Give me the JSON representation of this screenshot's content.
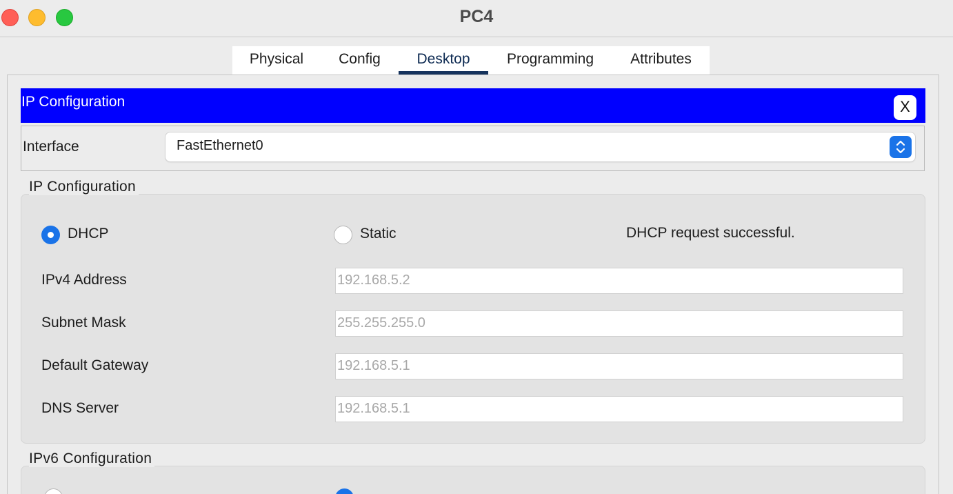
{
  "window": {
    "title": "PC4"
  },
  "tabs": [
    {
      "label": "Physical"
    },
    {
      "label": "Config"
    },
    {
      "label": "Desktop",
      "active": true
    },
    {
      "label": "Programming"
    },
    {
      "label": "Attributes"
    }
  ],
  "ip_config_bar": {
    "title": "IP Configuration",
    "close_label": "X"
  },
  "interface": {
    "label": "Interface",
    "selected": "FastEthernet0"
  },
  "ipv4_group": {
    "title": "IP Configuration",
    "mode_dhcp": "DHCP",
    "mode_static": "Static",
    "selected_mode": "DHCP",
    "status": "DHCP request successful.",
    "fields": [
      {
        "label": "IPv4 Address",
        "value": "192.168.5.2"
      },
      {
        "label": "Subnet Mask",
        "value": "255.255.255.0"
      },
      {
        "label": "Default Gateway",
        "value": "192.168.5.1"
      },
      {
        "label": "DNS Server",
        "value": "192.168.5.1"
      }
    ]
  },
  "ipv6_group": {
    "title": "IPv6 Configuration"
  },
  "colors": {
    "header_bar": "#0000ff",
    "accent": "#1a73e8",
    "active_tab": "#15325c"
  }
}
